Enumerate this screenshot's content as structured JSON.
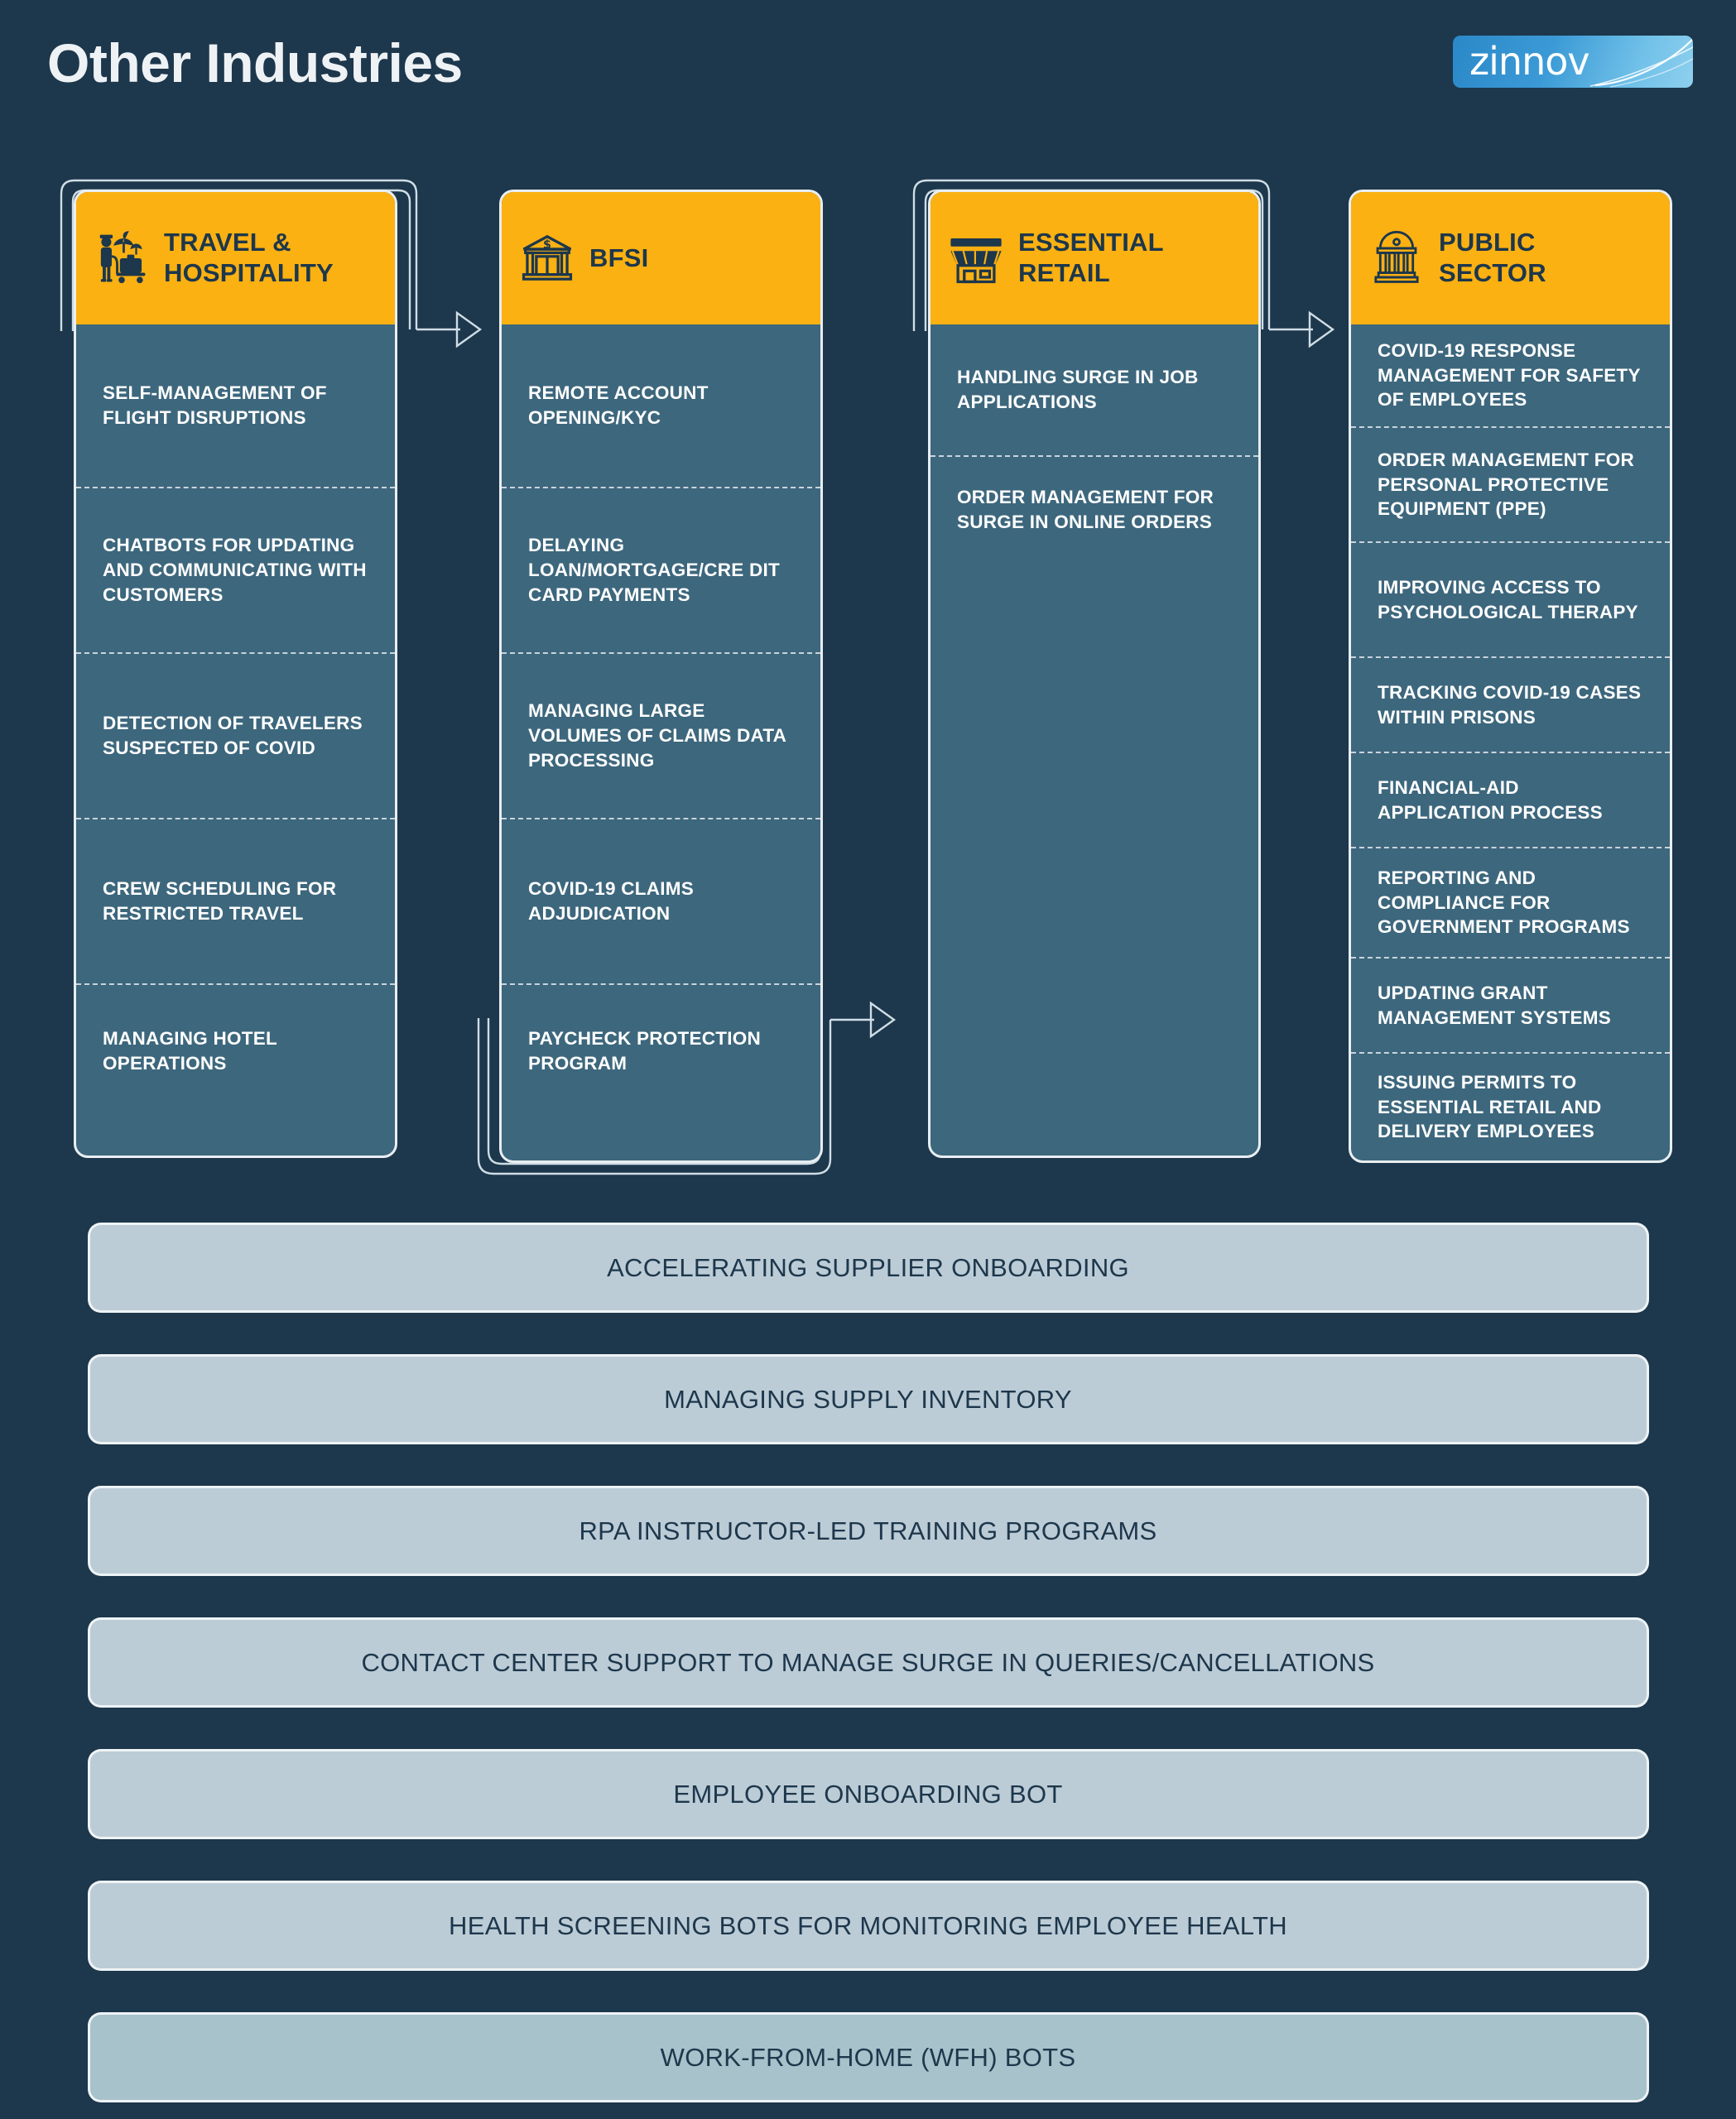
{
  "header": {
    "title": "Other Industries",
    "logo_text": "zinnov",
    "logo_icon": "swoosh-icon"
  },
  "colors": {
    "background": "#1d374c",
    "card_body": "#3d677d",
    "card_header": "#fbb112",
    "card_header_text": "#1d374c",
    "bar": "#bcccd6",
    "bar_alt": "#a8c2cb",
    "outline": "#eef3f6",
    "title_text": "#eef2f5"
  },
  "columns": [
    {
      "id": "travel-hospitality",
      "title": "TRAVEL &\nHOSPITALITY",
      "title_lines": [
        "TRAVEL &",
        "HOSPITALITY"
      ],
      "icon": "bellhop-palm-luggage-icon",
      "items": [
        "SELF-MANAGEMENT OF FLIGHT DISRUPTIONS",
        "CHATBOTS FOR UPDATING AND COMMUNICATING WITH CUSTOMERS",
        "DETECTION OF TRAVELERS SUSPECTED OF COVID",
        "CREW SCHEDULING FOR RESTRICTED TRAVEL",
        "MANAGING HOTEL OPERATIONS"
      ]
    },
    {
      "id": "bfsi",
      "title": "BFSI",
      "title_lines": [
        "BFSI"
      ],
      "icon": "bank-dollar-icon",
      "items": [
        "REMOTE ACCOUNT OPENING/KYC",
        "DELAYING LOAN/MORTGAGE/CRE DIT CARD PAYMENTS",
        "MANAGING LARGE VOLUMES OF CLAIMS DATA PROCESSING",
        "COVID-19 CLAIMS ADJUDICATION",
        "PAYCHECK PROTECTION PROGRAM"
      ]
    },
    {
      "id": "essential-retail",
      "title": "ESSENTIAL\nRETAIL",
      "title_lines": [
        "ESSENTIAL",
        "RETAIL"
      ],
      "icon": "storefront-icon",
      "items": [
        "HANDLING SURGE IN JOB APPLICATIONS",
        "ORDER MANAGEMENT FOR SURGE IN ONLINE ORDERS"
      ]
    },
    {
      "id": "public-sector",
      "title": "PUBLIC\nSECTOR",
      "title_lines": [
        "PUBLIC",
        "SECTOR"
      ],
      "icon": "government-building-icon",
      "items": [
        "COVID-19 RESPONSE MANAGEMENT FOR SAFETY OF EMPLOYEES",
        "ORDER MANAGEMENT FOR PERSONAL PROTECTIVE EQUIPMENT (PPE)",
        "IMPROVING ACCESS TO PSYCHOLOGICAL THERAPY",
        "TRACKING COVID-19 CASES WITHIN PRISONS",
        "FINANCIAL-AID APPLICATION PROCESS",
        "REPORTING AND COMPLIANCE FOR GOVERNMENT PROGRAMS",
        "UPDATING GRANT MANAGEMENT SYSTEMS",
        "ISSUING PERMITS TO ESSENTIAL RETAIL AND DELIVERY EMPLOYEES"
      ]
    }
  ],
  "bars": [
    {
      "label": "ACCELERATING SUPPLIER ONBOARDING",
      "variant": "default"
    },
    {
      "label": "MANAGING SUPPLY INVENTORY",
      "variant": "default"
    },
    {
      "label": "RPA INSTRUCTOR-LED TRAINING PROGRAMS",
      "variant": "default"
    },
    {
      "label": "CONTACT CENTER SUPPORT TO MANAGE SURGE IN QUERIES/CANCELLATIONS",
      "variant": "default"
    },
    {
      "label": "EMPLOYEE ONBOARDING BOT",
      "variant": "default"
    },
    {
      "label": "HEALTH SCREENING BOTS FOR MONITORING EMPLOYEE HEALTH",
      "variant": "default"
    },
    {
      "label": "WORK-FROM-HOME (WFH) BOTS",
      "variant": "teal"
    }
  ]
}
